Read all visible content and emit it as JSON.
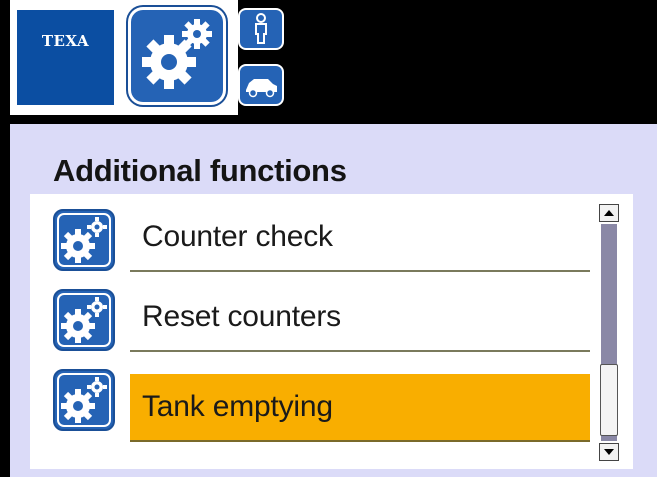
{
  "header": {
    "brand": "TEXA",
    "main_icon": "gears-icon",
    "buttons": [
      {
        "icon": "person-icon"
      },
      {
        "icon": "car-icon"
      }
    ]
  },
  "page": {
    "title": "Additional functions"
  },
  "list": {
    "items": [
      {
        "label": "Counter check",
        "icon": "gears-icon",
        "selected": false
      },
      {
        "label": "Reset counters",
        "icon": "gears-icon",
        "selected": false
      },
      {
        "label": "Tank emptying",
        "icon": "gears-icon",
        "selected": true
      }
    ]
  },
  "scrollbar": {
    "up_icon": "arrow-up-icon",
    "down_icon": "arrow-down-icon"
  },
  "colors": {
    "brand_blue": "#0b4ea2",
    "panel_bg": "#dbdbf8",
    "selected_bg": "#f9ae00"
  }
}
